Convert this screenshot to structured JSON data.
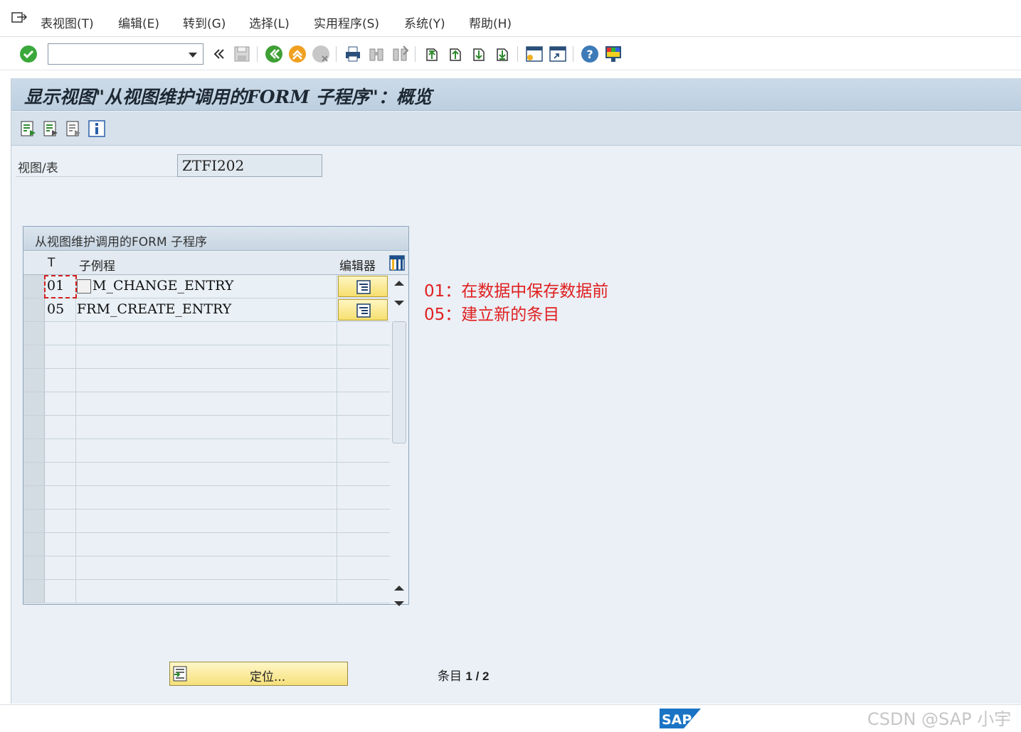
{
  "menu": {
    "items": [
      "表视图(T)",
      "编辑(E)",
      "转到(G)",
      "选择(L)",
      "实用程序(S)",
      "系统(Y)",
      "帮助(H)"
    ]
  },
  "toolbar": {
    "command_field_value": "",
    "icons": [
      "enter-icon",
      "back-double-icon",
      "save-icon",
      "back-icon",
      "exit-icon",
      "cancel-icon",
      "print-icon",
      "find-icon",
      "find-next-icon",
      "first-page-icon",
      "previous-page-icon",
      "next-page-icon",
      "last-page-icon",
      "create-session-icon",
      "shortcut-icon",
      "help-icon",
      "layout-icon"
    ]
  },
  "screen": {
    "title": "显示视图\"从视图维护调用的FORM 子程序\"：概览",
    "app_icons": [
      "detail-icon",
      "export-icon",
      "print-view-icon",
      "info-icon"
    ]
  },
  "field": {
    "label": "视图/表",
    "value": "ZTFI202"
  },
  "table": {
    "title": "从视图维护调用的FORM 子程序",
    "columns": [
      "T",
      "子例程",
      "编辑器"
    ],
    "rows": [
      {
        "t": "01",
        "routine": "M_CHANGE_ENTRY"
      },
      {
        "t": "05",
        "routine": "FRM_CREATE_ENTRY"
      }
    ]
  },
  "annotations": [
    "01：在数据中保存数据前",
    "05：建立新的条目"
  ],
  "bottom": {
    "locate_label": "定位...",
    "entry_prefix": "条目",
    "entry_count": "1 / 2"
  },
  "status": {
    "logo_text": "SAP",
    "watermark": "CSDN @SAP 小宇"
  }
}
